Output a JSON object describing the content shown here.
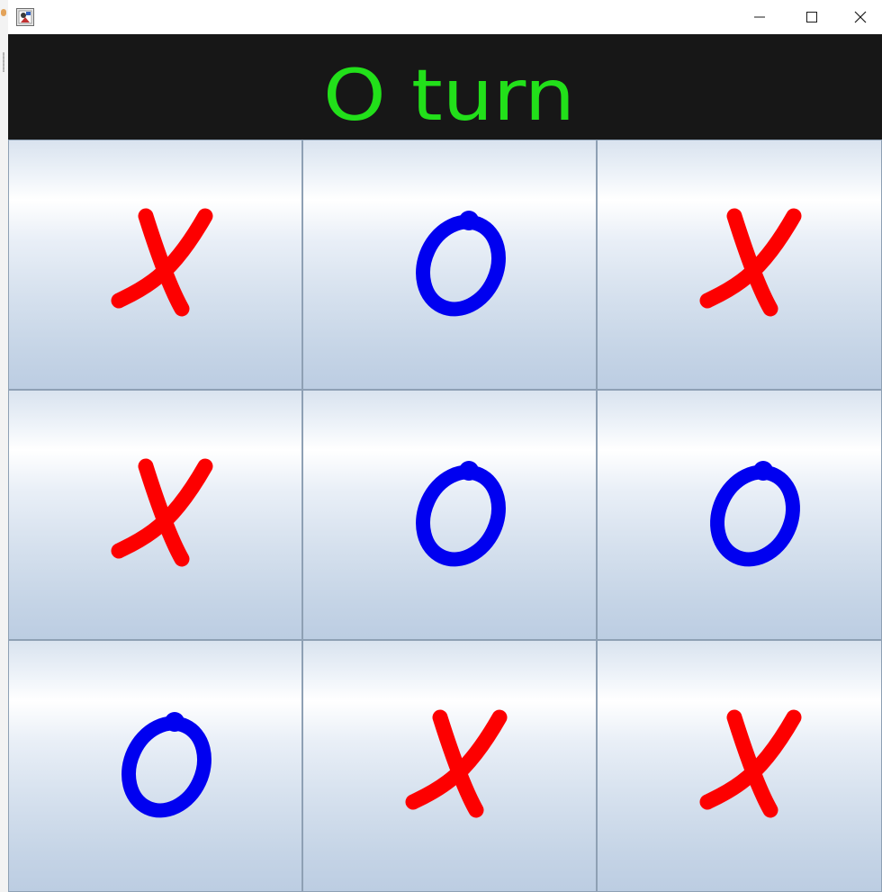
{
  "window": {
    "app_icon": "java-app-icon",
    "controls": [
      "minimize-icon",
      "maximize-icon",
      "close-icon"
    ]
  },
  "header": {
    "status": "O turn",
    "background": "#171717",
    "text_color": "#22e01a"
  },
  "colors": {
    "x": "#fd0000",
    "o": "#0000f0"
  },
  "board": [
    [
      "X",
      "O",
      "X"
    ],
    [
      "X",
      "O",
      "O"
    ],
    [
      "O",
      "X",
      "X"
    ]
  ]
}
